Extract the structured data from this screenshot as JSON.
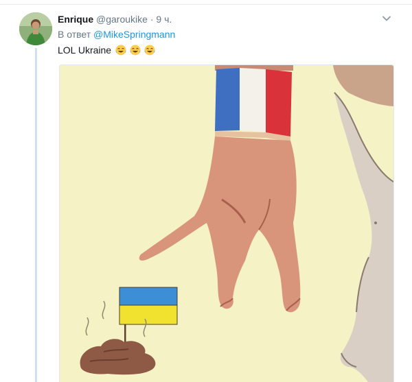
{
  "tweet": {
    "author_name": "Enrique",
    "author_handle": "@garoukike",
    "separator": "·",
    "time": "9 ч.",
    "reply_prefix": "В ответ",
    "reply_handle": "@MikeSpringmann",
    "text": "LOL Ukraine",
    "emojis": [
      "joy-emoji",
      "joy-emoji",
      "joy-emoji"
    ]
  },
  "icons": {
    "caret": "chevron-down-icon"
  },
  "colors": {
    "name": "#14171a",
    "muted": "#657786",
    "link": "#1b95e0",
    "thread_line": "#cfe2f3",
    "image_background": "#f5f2c6",
    "flag_blue": "#3c8fd6",
    "flag_yellow": "#f2e230"
  }
}
